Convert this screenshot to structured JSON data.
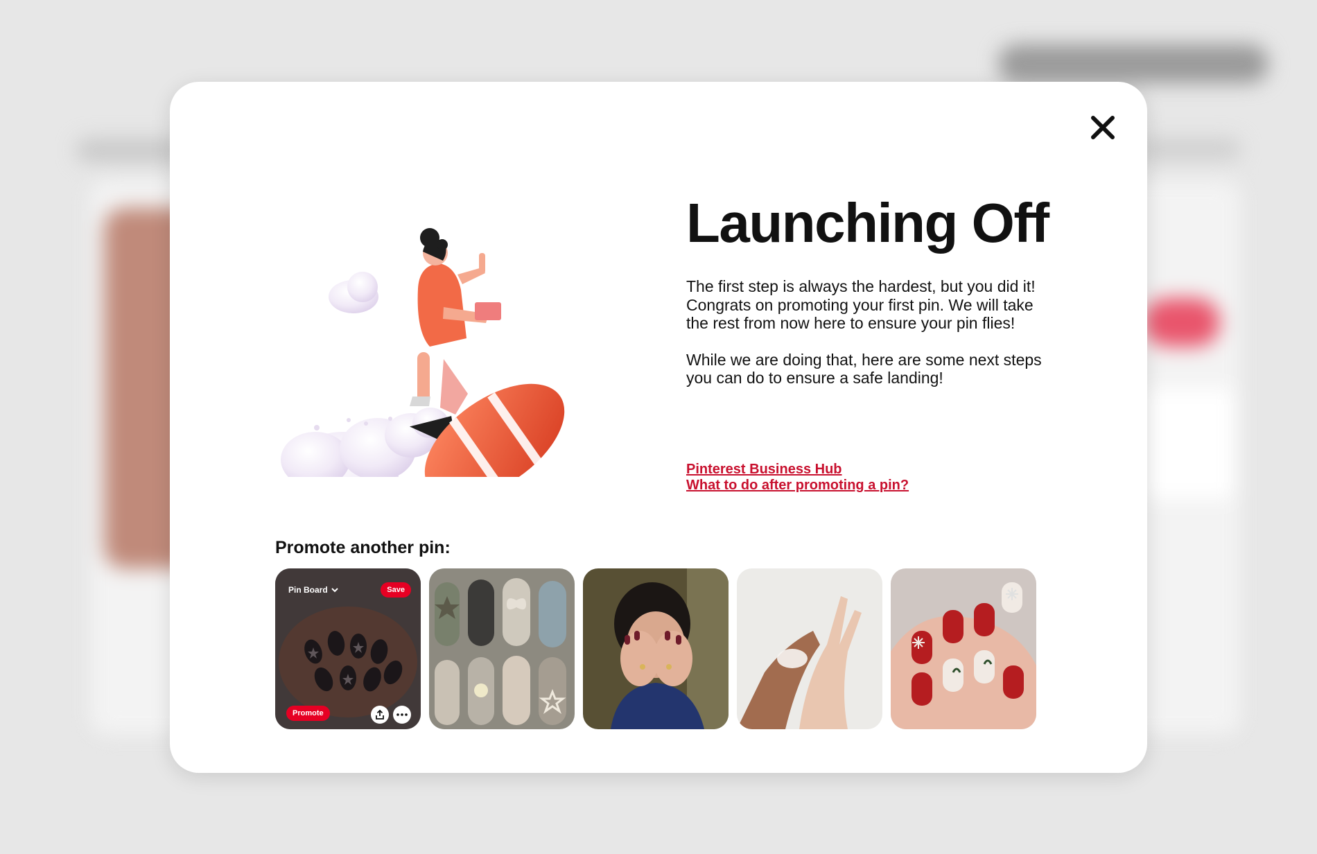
{
  "modal": {
    "title": "Launching Off",
    "paragraph_1": "The first step is always the hardest, but you did it! Congrats on promoting your first pin. We will take the rest from now here to ensure your pin flies!",
    "paragraph_2": "While we are doing that, here are some next steps you can do to ensure a safe landing!",
    "links": [
      {
        "label": "Pinterest Business Hub"
      },
      {
        "label": "What to do after promoting a pin? "
      }
    ],
    "promote_label": "Promote another pin:",
    "close_icon": "close-icon"
  },
  "pins": [
    {
      "board_label": "Pin Board",
      "save_label": "Save",
      "promote_label": "Promote"
    }
  ],
  "colors": {
    "accent": "#e60023",
    "link": "#c8102e"
  }
}
